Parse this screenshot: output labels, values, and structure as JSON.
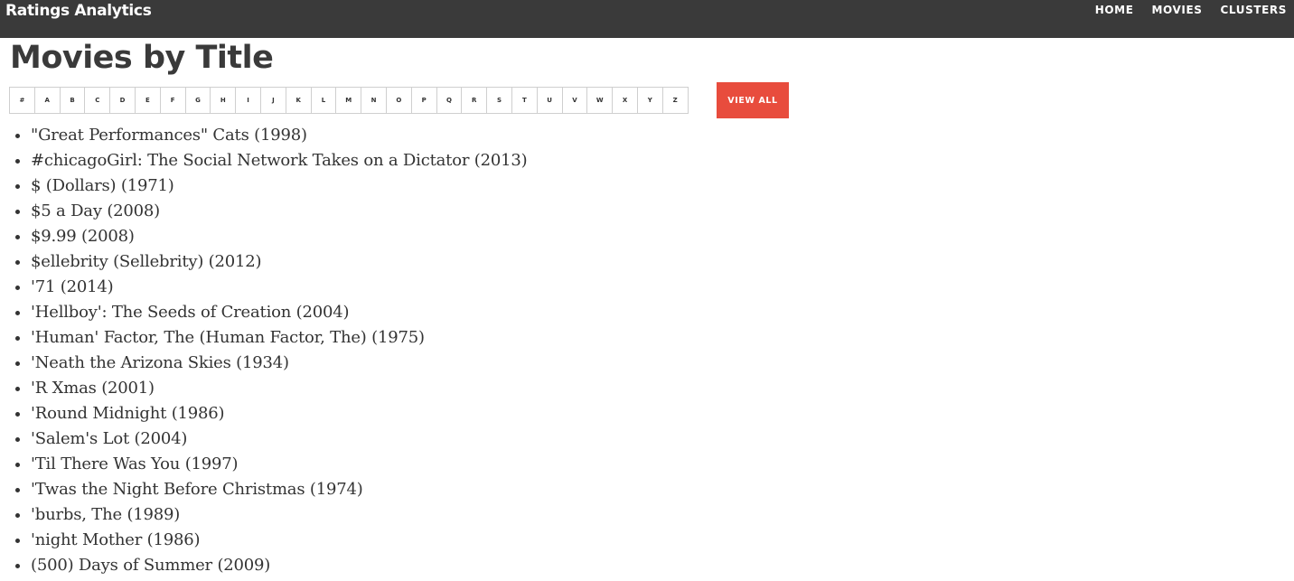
{
  "navbar": {
    "brand": "Ratings Analytics",
    "links": [
      "HOME",
      "MOVIES",
      "CLUSTERS"
    ]
  },
  "page": {
    "title": "Movies by Title"
  },
  "filter": {
    "letters": [
      "#",
      "A",
      "B",
      "C",
      "D",
      "E",
      "F",
      "G",
      "H",
      "I",
      "J",
      "K",
      "L",
      "M",
      "N",
      "O",
      "P",
      "Q",
      "R",
      "S",
      "T",
      "U",
      "V",
      "W",
      "X",
      "Y",
      "Z"
    ],
    "view_all_label": "VIEW ALL"
  },
  "movies": [
    "\"Great Performances\" Cats (1998)",
    "#chicagoGirl: The Social Network Takes on a Dictator (2013)",
    "$ (Dollars) (1971)",
    "$5 a Day (2008)",
    "$9.99 (2008)",
    "$ellebrity (Sellebrity) (2012)",
    "'71 (2014)",
    "'Hellboy': The Seeds of Creation (2004)",
    "'Human' Factor, The (Human Factor, The) (1975)",
    "'Neath the Arizona Skies (1934)",
    "'R Xmas (2001)",
    "'Round Midnight (1986)",
    "'Salem's Lot (2004)",
    "'Til There Was You (1997)",
    "'Twas the Night Before Christmas (1974)",
    "'burbs, The (1989)",
    "'night Mother (1986)",
    "(500) Days of Summer (2009)"
  ],
  "colors": {
    "navbar_bg": "#3a3a3a",
    "accent": "#e84c3d",
    "text": "#333333"
  }
}
